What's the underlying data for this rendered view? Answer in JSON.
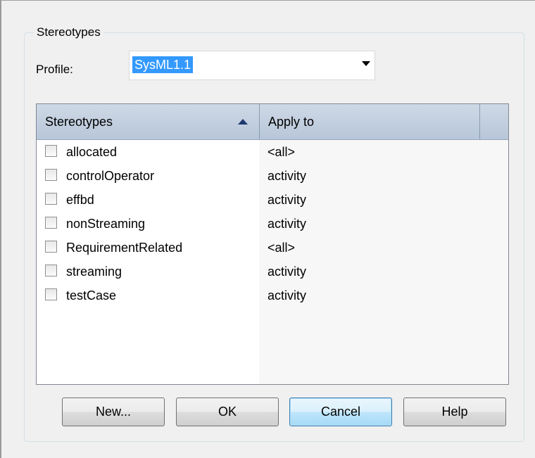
{
  "group": {
    "title": "Stereotypes"
  },
  "profile": {
    "label": "Profile:",
    "value": "SysML1.1"
  },
  "table": {
    "columns": [
      "Stereotypes",
      "Apply to"
    ],
    "rows": [
      {
        "name": "allocated",
        "apply_to": "<all>",
        "checked": false
      },
      {
        "name": "controlOperator",
        "apply_to": "activity",
        "checked": false
      },
      {
        "name": "effbd",
        "apply_to": "activity",
        "checked": false
      },
      {
        "name": "nonStreaming",
        "apply_to": "activity",
        "checked": false
      },
      {
        "name": "RequirementRelated",
        "apply_to": "<all>",
        "checked": false
      },
      {
        "name": "streaming",
        "apply_to": "activity",
        "checked": false
      },
      {
        "name": "testCase",
        "apply_to": "activity",
        "checked": false
      }
    ]
  },
  "buttons": {
    "new": "New...",
    "ok": "OK",
    "cancel": "Cancel",
    "help": "Help"
  },
  "colors": {
    "selection": "#3399ff",
    "header": "#c5d2e1",
    "default_button": "#bee6fd"
  }
}
